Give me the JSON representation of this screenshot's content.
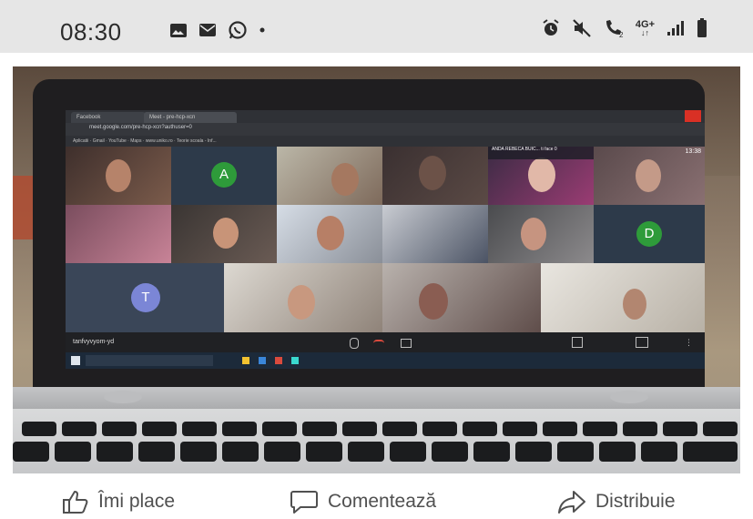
{
  "status_bar": {
    "time": "08:30",
    "network_label": "4G+",
    "left_icons": [
      "image-icon",
      "mail-icon",
      "whatsapp-icon",
      "dot-icon"
    ],
    "right_icons": [
      "alarm-icon",
      "mute-icon",
      "volte-call-icon",
      "network-4g-icon",
      "signal-icon",
      "battery-icon"
    ]
  },
  "photo": {
    "description_icons": [
      "laptop-screen",
      "video-call-grid"
    ],
    "screen": {
      "tab_1": "Facebook",
      "tab_2": "Meet - pre-hcp-xcn",
      "address": "meet.google.com/pre-hcp-xcn?authuser=0",
      "bookmarks": [
        "Aplicatii",
        "Gmail",
        "YouTube",
        "Maps",
        "www.uniko.ro",
        "Teorie scoala - Inf..."
      ],
      "presenter_name": "ANDA REBECA BUIC... ti face 0",
      "call_time": "13:38",
      "meet_code": "tanfvyvyom-yd",
      "tiles": [
        {
          "avatar": "A",
          "color": "#2e9b3a"
        },
        {
          "avatar": "D",
          "color": "#2e9b3a"
        },
        {
          "avatar": "T",
          "color": "#7b86d6"
        }
      ]
    }
  },
  "actions": {
    "like": "Îmi place",
    "comment": "Comentează",
    "share": "Distribuie"
  }
}
